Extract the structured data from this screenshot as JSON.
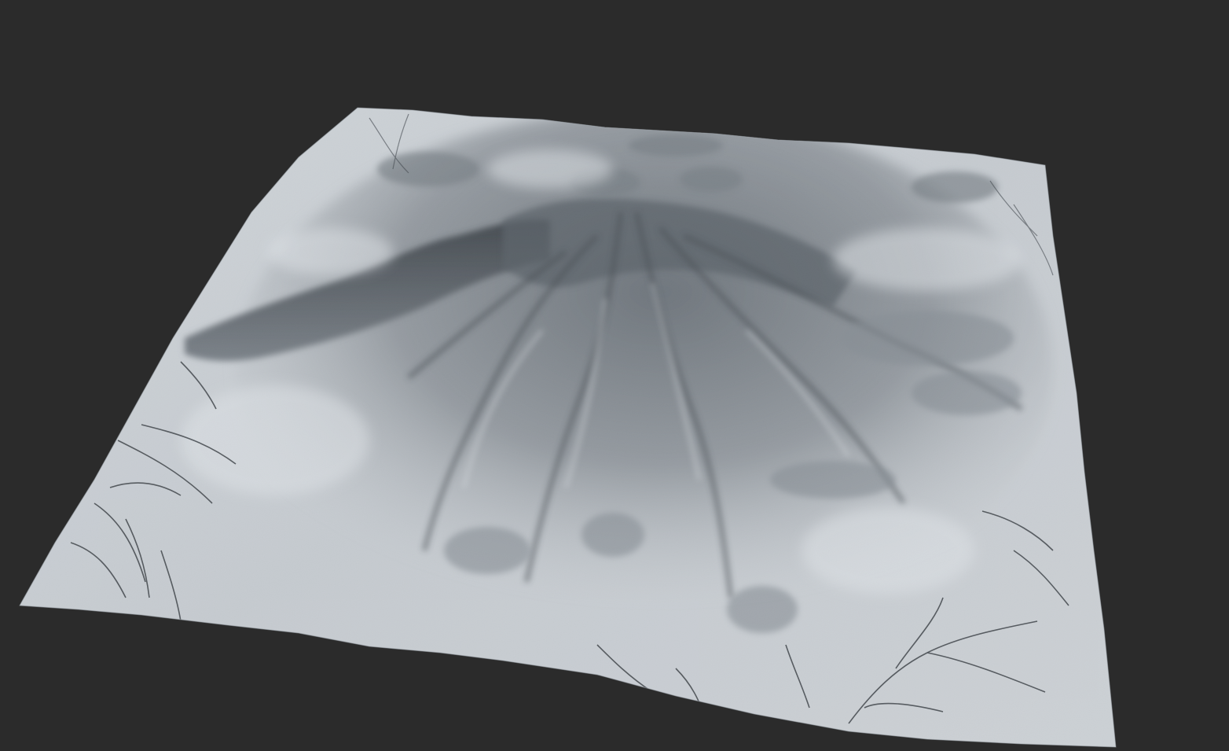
{
  "viewport": {
    "background_color": "#2b2b2b"
  },
  "terrain": {
    "subject": "mountain-terrain-heightmap",
    "render_style": "hillshade",
    "base_color": "#c9ced3",
    "highlight_color": "#e6eaee",
    "shadow_color": "#3b424a",
    "channel_color": "#1e2328"
  }
}
